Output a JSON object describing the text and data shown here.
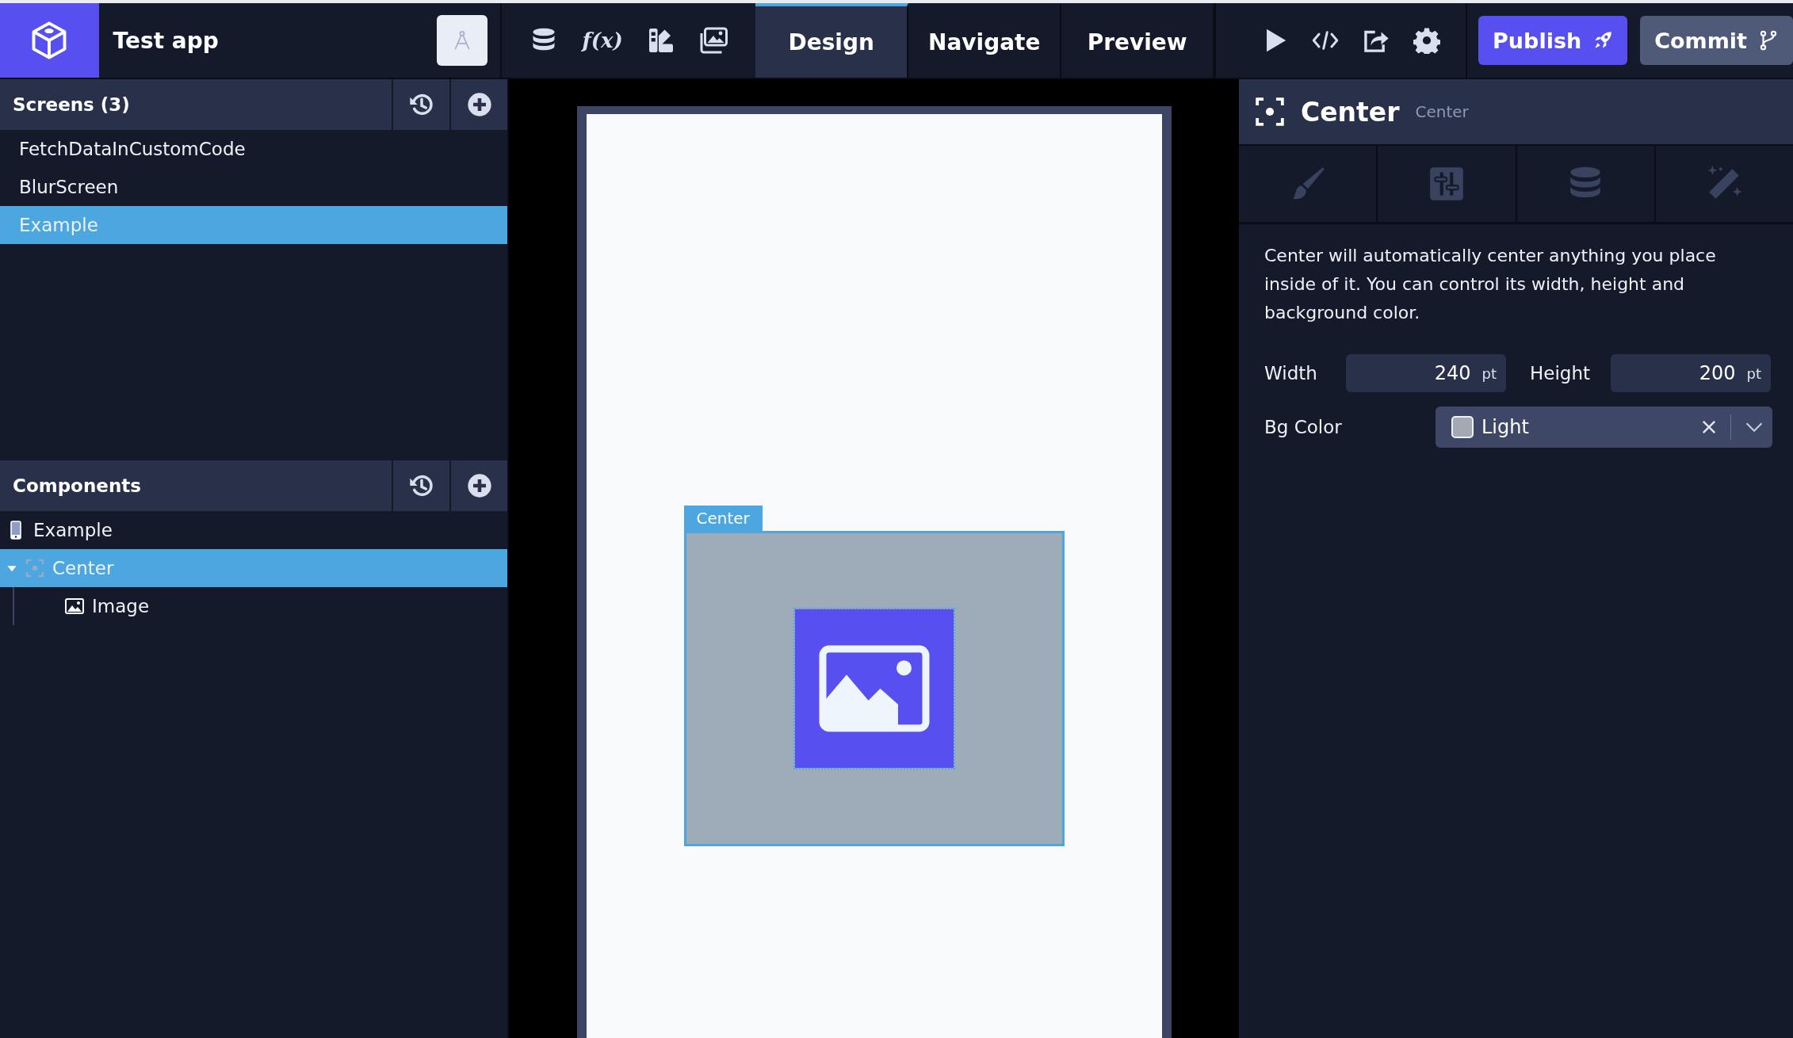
{
  "app": {
    "name": "Test app"
  },
  "toolbar": [
    {
      "kind": "database"
    },
    {
      "kind": "function",
      "glyph": "f(x)"
    },
    {
      "kind": "palette"
    },
    {
      "kind": "media"
    }
  ],
  "tabs": [
    {
      "label": "Design",
      "selected": true
    },
    {
      "label": "Navigate",
      "selected": false
    },
    {
      "label": "Preview",
      "selected": false
    }
  ],
  "actions": [
    {
      "kind": "play"
    },
    {
      "kind": "code"
    },
    {
      "kind": "share"
    },
    {
      "kind": "settings"
    }
  ],
  "buttons": [
    {
      "label": "Publish",
      "kind": "primary"
    },
    {
      "label": "Commit",
      "kind": "secondary"
    }
  ],
  "screens": {
    "title": "Screens (3)",
    "items": [
      {
        "label": "FetchDataInCustomCode",
        "selected": false
      },
      {
        "label": "BlurScreen",
        "selected": false
      },
      {
        "label": "Example",
        "selected": true
      }
    ]
  },
  "components": {
    "title": "Components",
    "tree": [
      {
        "label": "Example",
        "kind": "screen",
        "selected": false
      },
      {
        "label": "Center",
        "kind": "center",
        "selected": true,
        "expanded": true,
        "children": [
          {
            "label": "Image",
            "kind": "image",
            "selected": false
          }
        ]
      }
    ]
  },
  "canvas": {
    "selection_label": "Center"
  },
  "inspector": {
    "title": "Center",
    "subtitle": "Center",
    "tabs": [
      {
        "kind": "style"
      },
      {
        "kind": "layout"
      },
      {
        "kind": "data"
      },
      {
        "kind": "magic"
      }
    ],
    "description": "Center will automatically center anything you place inside of it. You can control its width, height and background color.",
    "fields": [
      {
        "label": "Width",
        "value": "240",
        "unit": "pt"
      },
      {
        "label": "Height",
        "value": "200",
        "unit": "pt"
      }
    ],
    "bg_color": {
      "label": "Bg Color",
      "value": "Light"
    }
  }
}
